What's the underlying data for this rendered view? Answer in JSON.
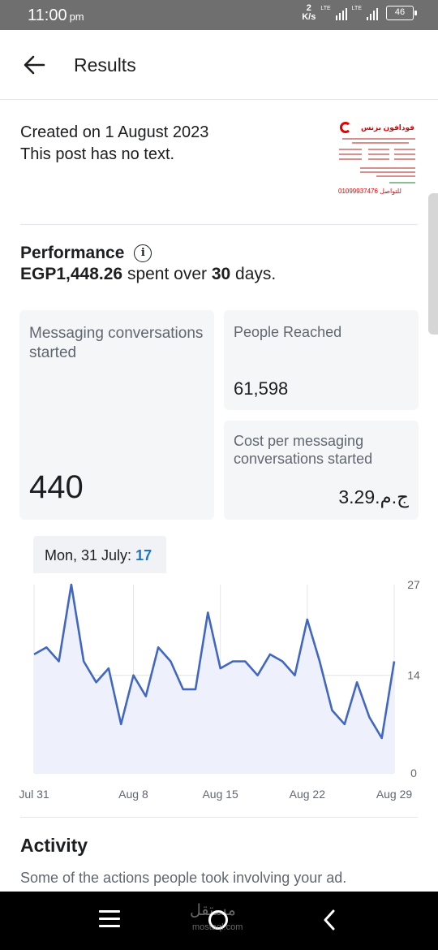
{
  "status_bar": {
    "time": "11:00",
    "ampm": "pm",
    "net_speed_value": "2",
    "net_speed_unit": "K/s",
    "lte_1": "LTE",
    "lte_2": "LTE",
    "battery": "46"
  },
  "header": {
    "title": "Results"
  },
  "post": {
    "created": "Created on 1 August 2023",
    "text_note": "This post has no text.",
    "thumbnail": {
      "brand": "فودافون بزنس",
      "phone": "01099937476 للتواصل"
    }
  },
  "performance": {
    "title": "Performance",
    "amount": "EGP1,448.26",
    "spent_over": "spent over",
    "days_count": "30",
    "days_word": "days."
  },
  "metrics": [
    {
      "label": "Messaging conversations started",
      "value": "440"
    },
    {
      "label": "People Reached",
      "value": "61,598"
    },
    {
      "label": "Cost per messaging conversations started",
      "value": "ج.م.‏3.29"
    }
  ],
  "tooltip": {
    "label": "Mon, 31 July:",
    "value": "17"
  },
  "chart_data": {
    "type": "area",
    "x": [
      "Jul 31",
      "Aug 1",
      "Aug 2",
      "Aug 3",
      "Aug 4",
      "Aug 5",
      "Aug 6",
      "Aug 7",
      "Aug 8",
      "Aug 9",
      "Aug 10",
      "Aug 11",
      "Aug 12",
      "Aug 13",
      "Aug 14",
      "Aug 15",
      "Aug 16",
      "Aug 17",
      "Aug 18",
      "Aug 19",
      "Aug 20",
      "Aug 21",
      "Aug 22",
      "Aug 23",
      "Aug 24",
      "Aug 25",
      "Aug 26",
      "Aug 27",
      "Aug 28",
      "Aug 29"
    ],
    "values": [
      17,
      18,
      16,
      27,
      16,
      13,
      15,
      7,
      14,
      11,
      18,
      16,
      12,
      12,
      23,
      15,
      16,
      16,
      14,
      17,
      16,
      14,
      22,
      16,
      9,
      7,
      13,
      8,
      5,
      16
    ],
    "x_tick_labels": [
      "Jul 31",
      "Aug 8",
      "Aug 15",
      "Aug 22",
      "Aug 29"
    ],
    "y_tick_labels": [
      "27",
      "14",
      "0"
    ],
    "ylim": [
      0,
      27
    ],
    "grid": true,
    "line_color": "#4267c0",
    "fill_color": "#eef1fb"
  },
  "activity": {
    "title": "Activity",
    "subtitle": "Some of the actions people took involving your ad."
  },
  "watermark": {
    "main": "مستقل",
    "sub": "mostaql.com"
  }
}
